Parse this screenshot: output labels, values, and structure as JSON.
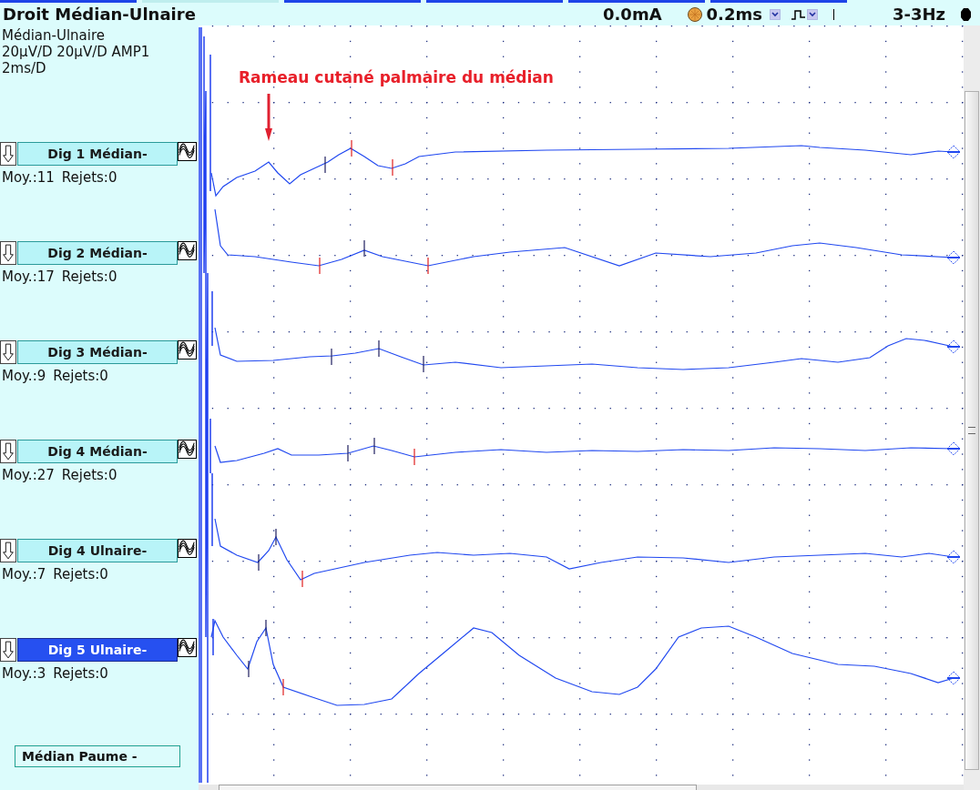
{
  "tabs": [
    {
      "selected": false
    },
    {
      "selected": true
    },
    {
      "selected": false
    },
    {
      "selected": false
    },
    {
      "selected": false
    },
    {
      "selected": false
    }
  ],
  "header": {
    "title": "Droit Médian-Ulnaire",
    "intensity": "0.0mA",
    "duration": "0.2ms",
    "frequency": "3-3Hz"
  },
  "info": [
    "Médian-Ulnaire",
    "20µV/D 20µV/D AMP1",
    "2ms/D"
  ],
  "channels": [
    {
      "label": "Dig 1  Médian-",
      "averages": "Moy.:11",
      "rejects": "Rejets:0",
      "selected": false
    },
    {
      "label": "Dig 2 Médian-",
      "averages": "Moy.:17",
      "rejects": "Rejets:0",
      "selected": false
    },
    {
      "label": "Dig 3 Médian-",
      "averages": "Moy.:9",
      "rejects": "Rejets:0",
      "selected": false
    },
    {
      "label": "Dig 4 Médian-",
      "averages": "Moy.:27",
      "rejects": "Rejets:0",
      "selected": false
    },
    {
      "label": "Dig 4 Ulnaire-",
      "averages": "Moy.:7",
      "rejects": "Rejets:0",
      "selected": false
    },
    {
      "label": "Dig 5 Ulnaire-",
      "averages": "Moy.:3",
      "rejects": "Rejets:0",
      "selected": true
    }
  ],
  "extra_label": "Médian Paume -",
  "annotation": "Rameau cutané palmaire du médian"
}
